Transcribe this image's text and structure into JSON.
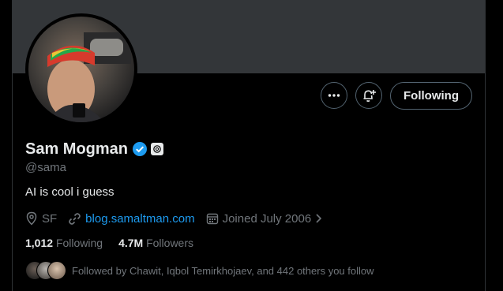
{
  "profile": {
    "display_name": "Sam Mogman",
    "handle": "@sama",
    "bio": "AI is cool i guess",
    "location": "SF",
    "website": "blog.samaltman.com",
    "joined": "Joined July 2006",
    "following_count": "1,012",
    "following_label": "Following",
    "followers_count": "4.7M",
    "followers_label": "Followers",
    "followed_by_text": "Followed by Chawit, Iqbol Temirkhojaev, and 442 others you follow"
  },
  "actions": {
    "follow_label": "Following"
  },
  "icons": {
    "more": "more-horizontal-icon",
    "bell": "notification-bell-plus-icon",
    "verified": "verified-badge-icon",
    "affiliation": "openai-affiliation-icon",
    "location": "location-pin-icon",
    "link": "link-icon",
    "calendar": "calendar-icon",
    "chevron": "chevron-right-icon"
  },
  "colors": {
    "background": "#000000",
    "banner": "#333639",
    "accent": "#1d9bf0",
    "text_primary": "#e7e9ea",
    "text_secondary": "#71767b",
    "border": "#536471"
  }
}
